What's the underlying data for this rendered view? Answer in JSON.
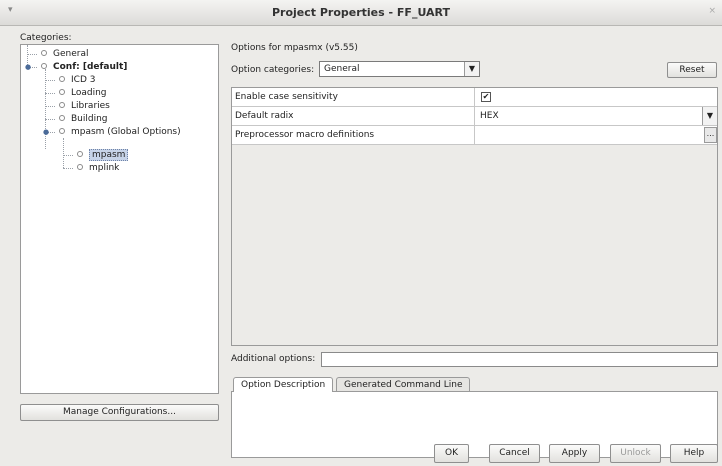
{
  "window": {
    "title": "Project Properties - FF_UART",
    "menu_glyph": "▾",
    "close_glyph": "×"
  },
  "categories": {
    "label": "Categories:",
    "items": [
      {
        "label": "General"
      },
      {
        "label": "Conf: [default]"
      },
      {
        "label": "ICD 3"
      },
      {
        "label": "Loading"
      },
      {
        "label": "Libraries"
      },
      {
        "label": "Building"
      },
      {
        "label": "mpasm (Global Options)"
      },
      {
        "label": "mpasm"
      },
      {
        "label": "mplink"
      }
    ],
    "manage_button": "Manage Configurations..."
  },
  "options": {
    "header": "Options for mpasmx (v5.55)",
    "category_label": "Option categories:",
    "category_value": "General",
    "reset_button": "Reset",
    "rows": [
      {
        "name": "Enable case sensitivity",
        "checked": true,
        "check_glyph": "✔"
      },
      {
        "name": "Default radix",
        "value": "HEX"
      },
      {
        "name": "Preprocessor macro definitions",
        "value": "",
        "ellipsis": "..."
      }
    ],
    "additional_label": "Additional options:",
    "additional_value": ""
  },
  "tabs": [
    {
      "label": "Option Description"
    },
    {
      "label": "Generated Command Line"
    }
  ],
  "buttons": {
    "ok": "OK",
    "cancel": "Cancel",
    "apply": "Apply",
    "unlock": "Unlock",
    "help": "Help"
  },
  "icons": {
    "dropdown": "▼",
    "tree_expanded": "●"
  }
}
